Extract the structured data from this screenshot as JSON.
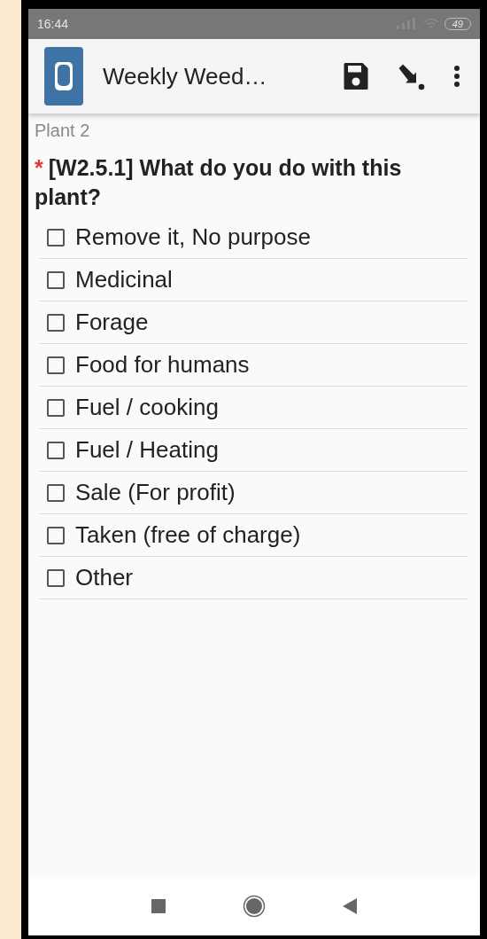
{
  "status_bar": {
    "time": "16:44",
    "battery": "49"
  },
  "toolbar": {
    "title": "Weekly Weed…"
  },
  "group_label": "Plant 2",
  "question": {
    "required_mark": "*",
    "text": "[W2.5.1] What do you do with this plant?"
  },
  "options": [
    {
      "label": "Remove it, No purpose",
      "checked": false
    },
    {
      "label": "Medicinal",
      "checked": false
    },
    {
      "label": "Forage",
      "checked": false
    },
    {
      "label": "Food for humans",
      "checked": false
    },
    {
      "label": "Fuel / cooking",
      "checked": false
    },
    {
      "label": "Fuel / Heating",
      "checked": false
    },
    {
      "label": "Sale (For profit)",
      "checked": false
    },
    {
      "label": "Taken (free of charge)",
      "checked": false
    },
    {
      "label": "Other",
      "checked": false
    }
  ]
}
